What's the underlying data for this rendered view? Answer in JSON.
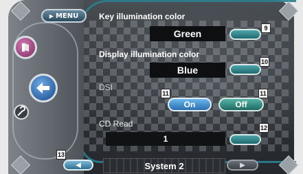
{
  "menu": {
    "label": "MENU"
  },
  "settings": [
    {
      "label": "Key illumination color",
      "value": "Green",
      "badge": "9"
    },
    {
      "label": "Display illumination color",
      "value": "Blue",
      "badge": "10"
    },
    {
      "label": "DSI"
    },
    {
      "label": "CD Read",
      "value": "1",
      "badge": "12"
    }
  ],
  "dsi": {
    "on_label": "On",
    "off_label": "Off",
    "on_badge": "11",
    "off_badge": "11",
    "selected": "On"
  },
  "footer": {
    "title": "System 2",
    "prev_badge": "13"
  },
  "colors": {
    "accent": "#2f8fa3",
    "on_active": "#2f7fb8",
    "off_btn": "#2a8a7e",
    "edit_btn": "#2e8a8d"
  },
  "icons": [
    "menu-play-icon",
    "music-disc-icon",
    "back-arrow-icon",
    "wrench-icon",
    "left-arrow-icon",
    "right-arrow-icon"
  ]
}
